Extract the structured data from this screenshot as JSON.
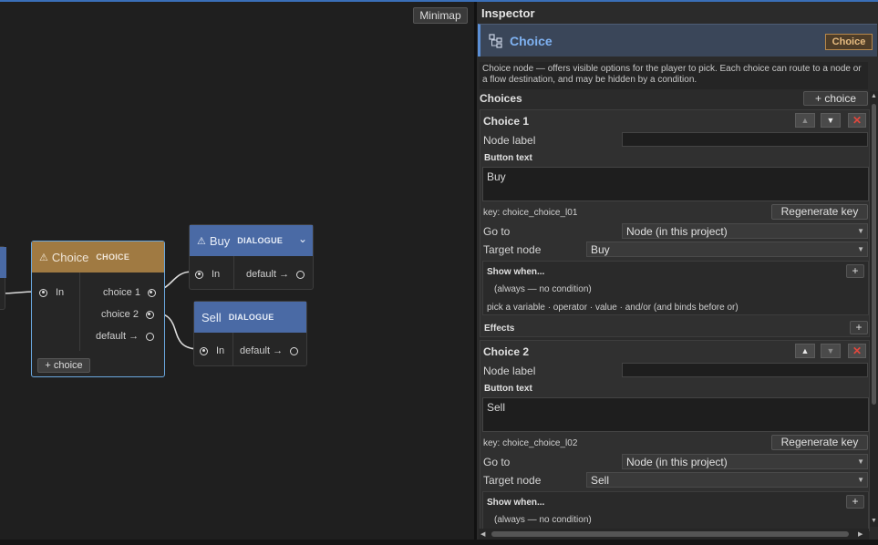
{
  "canvas": {
    "minimap_label": "Minimap",
    "nodes": {
      "choice": {
        "title": "Choice",
        "type": "CHOICE",
        "in_label": "In",
        "outputs": [
          "choice 1",
          "choice 2",
          "default →"
        ],
        "add_label": "+ choice",
        "color": "#a07a42"
      },
      "buy": {
        "title": "Buy",
        "type": "DIALOGUE",
        "in_label": "In",
        "out_label": "default →",
        "color": "#4a6aa5"
      },
      "sell": {
        "title": "Sell",
        "type": "DIALOGUE",
        "in_label": "In",
        "out_label": "default →",
        "color": "#4a6aa5"
      }
    }
  },
  "inspector": {
    "title": "Inspector",
    "node_name": "Choice",
    "badge": "Choice",
    "description": "Choice node — offers visible options for the player to pick. Each choice can route to a node or a flow destination, and may be hidden by a condition.",
    "choices_header": "Choices",
    "add_choice_label": "+ choice",
    "choices": [
      {
        "header": "Choice 1",
        "node_label_caption": "Node label",
        "node_label_value": "",
        "button_text_caption": "Button text",
        "button_text_value": "Buy",
        "key_text": "key: choice_choice_l01",
        "regen_label": "Regenerate key",
        "goto_caption": "Go to",
        "goto_value": "Node (in this project)",
        "target_caption": "Target node",
        "target_value": "Buy",
        "show_when_caption": "Show when...",
        "condition_text": "(always — no condition)",
        "condition_hint": "pick a variable · operator · value · and/or  (and binds before or)",
        "effects_caption": "Effects"
      },
      {
        "header": "Choice 2",
        "node_label_caption": "Node label",
        "node_label_value": "",
        "button_text_caption": "Button text",
        "button_text_value": "Sell",
        "key_text": "key: choice_choice_l02",
        "regen_label": "Regenerate key",
        "goto_caption": "Go to",
        "goto_value": "Node (in this project)",
        "target_caption": "Target node",
        "target_value": "Sell",
        "show_when_caption": "Show when...",
        "condition_text": "(always — no condition)"
      }
    ],
    "icons": {
      "up": "▲",
      "down": "▼",
      "remove": "✕",
      "plus": "+",
      "caret": "▼",
      "warning": "⚠",
      "collapse": "⌄"
    }
  }
}
